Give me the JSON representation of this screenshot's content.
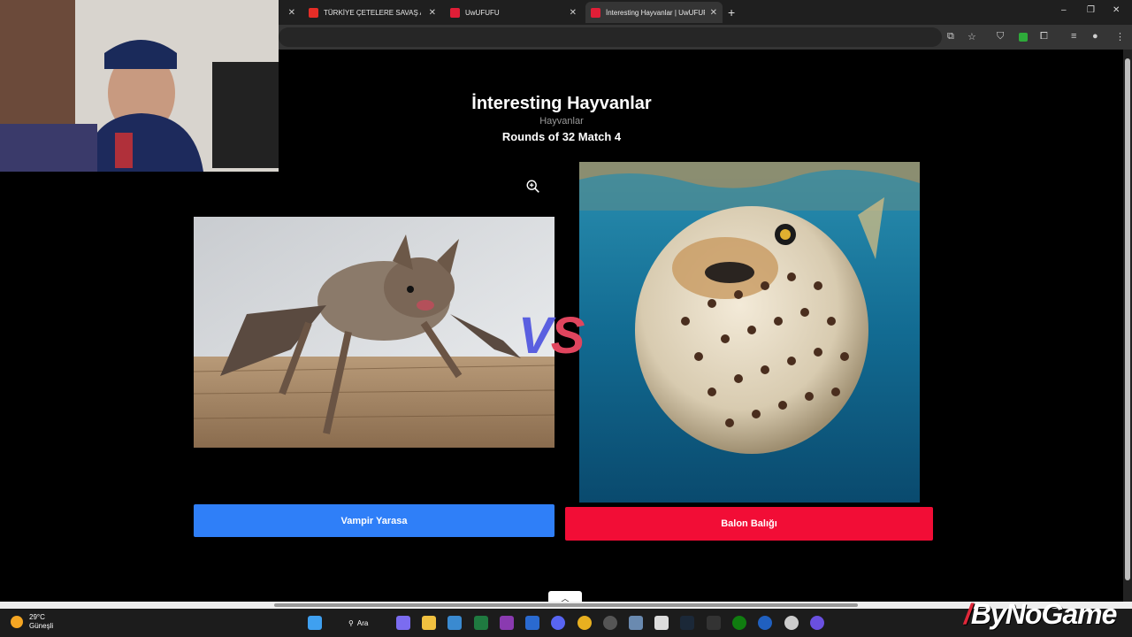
{
  "browser": {
    "tabs": [
      {
        "label": "",
        "favicon_color": "#c0392b",
        "active": false
      },
      {
        "label": "TÜRKİYE ÇETELERE SAVAŞ AÇTI",
        "favicon_color": "#e52d27",
        "active": false
      },
      {
        "label": "UwUFUFU",
        "favicon_color": "#e01e37",
        "active": false
      },
      {
        "label": "İnteresting Hayvanlar | UwUFUFU",
        "favicon_color": "#e01e37",
        "active": true
      }
    ],
    "new_tab_label": "+",
    "window_controls": [
      "–",
      "❐",
      "✕"
    ]
  },
  "page": {
    "title": "İnteresting Hayvanlar",
    "subtitle": "Hayvanlar",
    "round_info": "Rounds of 32 Match 4",
    "vs_v": "V",
    "vs_s": "S",
    "left_choice": {
      "label": "Vampir Yarasa",
      "color": "#2f7ff8",
      "image_icon": "bat-image"
    },
    "right_choice": {
      "label": "Balon Balığı",
      "color": "#f20d36",
      "image_icon": "pufferfish-image"
    },
    "scroll_up_glyph": "︿"
  },
  "taskbar": {
    "weather_temp": "29°C",
    "weather_desc": "Güneşli",
    "search_label": "Ara"
  },
  "watermark": {
    "text": "ByNoGame"
  }
}
